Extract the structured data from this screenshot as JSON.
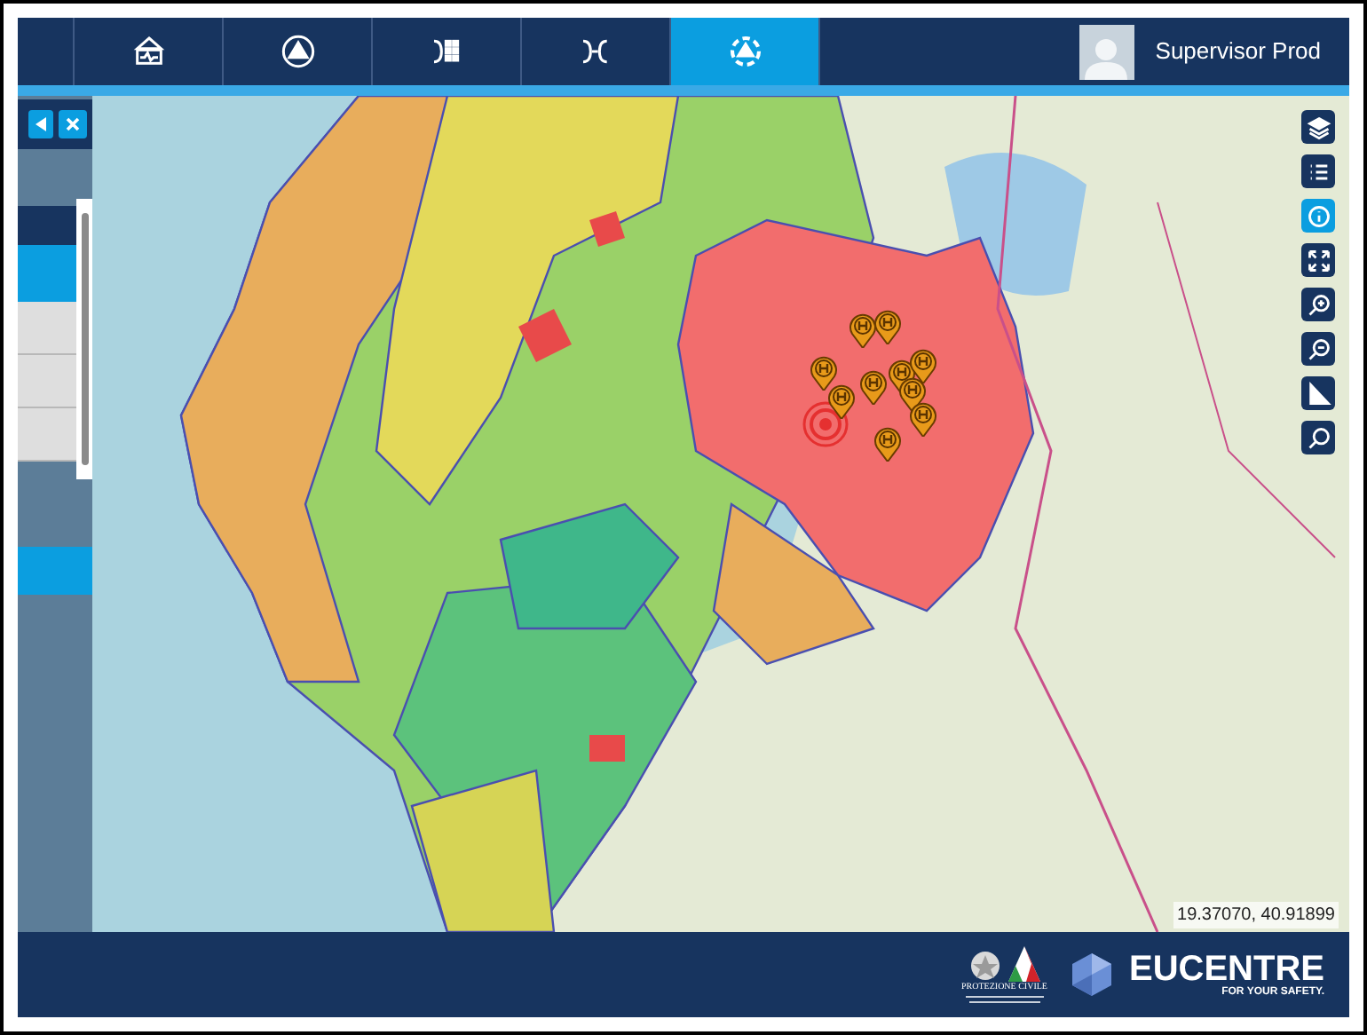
{
  "nav_tabs": [
    {
      "kind": "house",
      "selected": false
    },
    {
      "kind": "warning",
      "selected": false
    },
    {
      "kind": "grid",
      "selected": false
    },
    {
      "kind": "split",
      "selected": false
    },
    {
      "kind": "cycle",
      "selected": true
    }
  ],
  "user": {
    "name": "Supervisor Prod"
  },
  "side_panel": {
    "rows": [
      {
        "selected": true
      },
      {
        "selected": false
      },
      {
        "selected": false
      },
      {
        "selected": false
      }
    ]
  },
  "map_tools": [
    {
      "kind": "layers",
      "selected": false
    },
    {
      "kind": "legend",
      "selected": false
    },
    {
      "kind": "info",
      "selected": true
    },
    {
      "kind": "extent",
      "selected": false
    },
    {
      "kind": "zoom-in",
      "selected": false
    },
    {
      "kind": "zoom-out",
      "selected": false
    },
    {
      "kind": "measure",
      "selected": false
    },
    {
      "kind": "search",
      "selected": false
    }
  ],
  "coordinates": "19.37070, 40.91899",
  "footer": {
    "protezione_civile": "PROTEZIONE CIVILE",
    "eucentre": "EUCENTRE",
    "eucentre_tagline": "FOR YOUR SAFETY."
  }
}
